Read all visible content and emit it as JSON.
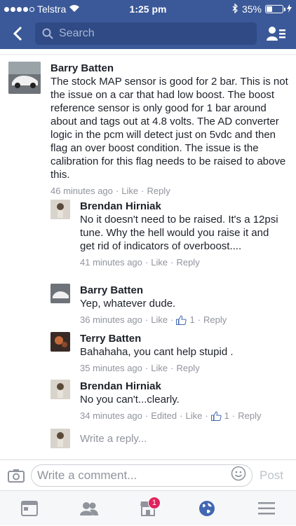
{
  "status_bar": {
    "carrier": "Telstra",
    "time": "1:25 pm",
    "battery": "35%",
    "battery_level": 0.35
  },
  "nav": {
    "search_placeholder": "Search"
  },
  "comments": [
    {
      "author": "Barry Batten",
      "text": "The stock MAP sensor is good for 2 bar. This is not the issue on a car that had low boost. The boost reference sensor is only good for 1 bar around about and tags out at 4.8 volts. The AD converter logic in the pcm will detect just on 5vdc and then flag an over boost condition. The issue is the calibration for this flag needs to be raised to above this.",
      "time": "46 minutes ago",
      "like": "Like",
      "reply": "Reply"
    },
    {
      "author": "Brendan Hirniak",
      "text": "No it doesn't need to be raised. It's a 12psi tune. Why the hell would you raise it and get rid of indicators of overboost....",
      "time": "41 minutes ago",
      "like": "Like",
      "reply": "Reply"
    },
    {
      "author": "Barry Batten",
      "text": "Yep, whatever dude.",
      "time": "36 minutes ago",
      "like": "Like",
      "reactions": "1",
      "reply": "Reply"
    },
    {
      "author": "Terry Batten",
      "text": "Bahahaha, you cant help stupid .",
      "time": "35 minutes ago",
      "like": "Like",
      "reply": "Reply"
    },
    {
      "author": "Brendan Hirniak",
      "text": "No you can't...clearly.",
      "time": "34 minutes ago",
      "edited": "Edited",
      "like": "Like",
      "reactions": "1",
      "reply": "Reply"
    }
  ],
  "reply_box": {
    "placeholder": "Write a reply..."
  },
  "composer": {
    "placeholder": "Write a comment...",
    "post_label": "Post"
  },
  "tab_bar": {
    "marketplace_badge": "1"
  },
  "colors": {
    "brand": "#3b5998",
    "meta_text": "#90949c",
    "badge": "#e0245e",
    "globe": "#4267b2"
  }
}
